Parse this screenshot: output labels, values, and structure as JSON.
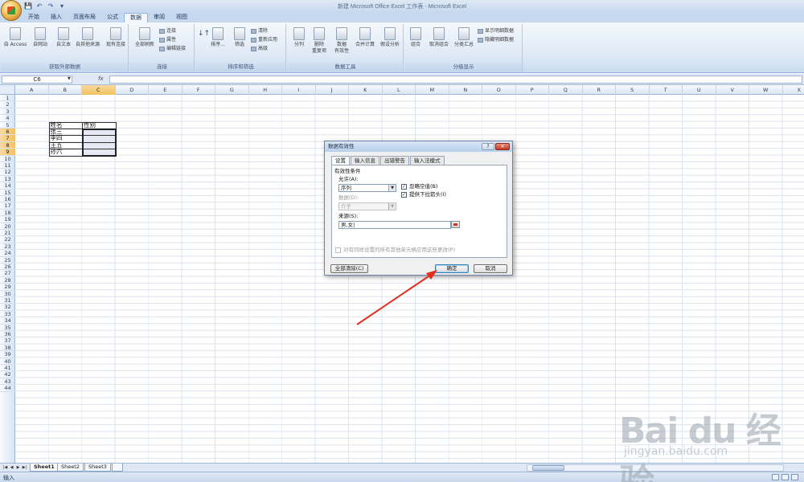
{
  "window": {
    "title": "新建 Microsoft Office Excel 工作表 - Microsoft Excel"
  },
  "qat": {
    "save": "💾",
    "undo": "↶",
    "redo": "↷",
    "more": "▾"
  },
  "tabs": [
    {
      "label": "开始"
    },
    {
      "label": "插入"
    },
    {
      "label": "页面布局"
    },
    {
      "label": "公式"
    },
    {
      "label": "数据",
      "active": true
    },
    {
      "label": "审阅"
    },
    {
      "label": "视图"
    }
  ],
  "ribbon": {
    "get_external": {
      "label": "获取外部数据",
      "buttons": [
        "自 Access",
        "自网站",
        "自文本",
        "自其他来源",
        "现有连接"
      ]
    },
    "connections": {
      "label": "连接",
      "refresh_all": "全部刷新",
      "small": [
        "连接",
        "属性",
        "编辑链接"
      ]
    },
    "sort_filter": {
      "label": "排序和筛选",
      "sort": "排序...",
      "filter": "筛选",
      "small": [
        "清除",
        "重新应用",
        "高级"
      ]
    },
    "data_tools": {
      "label": "数据工具",
      "buttons": [
        "分列",
        "删除\n重复项",
        "数据\n有效性",
        "合并计算",
        "假设分析"
      ]
    },
    "outline": {
      "label": "分级显示",
      "buttons": [
        "组合",
        "取消组合",
        "分类汇总"
      ],
      "small": [
        "显示明细数据",
        "隐藏明细数据"
      ]
    }
  },
  "formula_bar": {
    "name_box": "C6",
    "fx": "fx",
    "value": ""
  },
  "grid": {
    "columns": [
      "A",
      "B",
      "C",
      "D",
      "E",
      "F",
      "G",
      "H",
      "I",
      "J",
      "K",
      "L",
      "M",
      "N",
      "O",
      "P",
      "Q",
      "R",
      "S",
      "T",
      "U",
      "V",
      "W",
      "X"
    ],
    "selected_column": "C",
    "rows": 44,
    "selected_rows": [
      6,
      7,
      8,
      9
    ],
    "cells": {
      "B5": "姓名",
      "C5": "性别",
      "B6": "张三",
      "B7": "李四",
      "B8": "王五",
      "B9": "孙六"
    }
  },
  "dialog": {
    "title": "数据有效性",
    "help": "?",
    "close": "✕",
    "tabs": [
      "设置",
      "输入信息",
      "出错警告",
      "输入法模式"
    ],
    "section": "有效性条件",
    "allow_label": "允许(A):",
    "allow_value": "序列",
    "ignore_blank": "忽略空值(B)",
    "dropdown": "提供下拉箭头(I)",
    "data_label": "数据(D):",
    "data_value": "介于",
    "source_label": "来源(S):",
    "source_value": "男,女|",
    "apply_all": "对有同样设置的所有其他单元格应用这些更改(P)",
    "clear_all": "全部清除(C)",
    "ok": "确定",
    "cancel": "取消"
  },
  "sheets": {
    "tabs": [
      "Sheet1",
      "Sheet2",
      "Sheet3"
    ],
    "active": "Sheet1"
  },
  "status": {
    "mode": "输入"
  },
  "watermark": {
    "logo": "Bai du 经验",
    "url": "jingyan.baidu.com"
  }
}
